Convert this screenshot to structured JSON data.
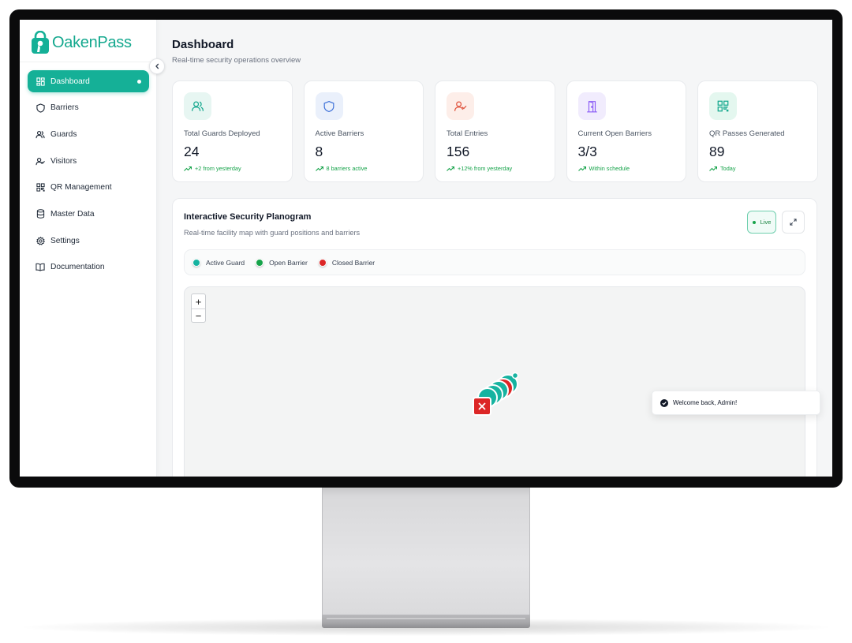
{
  "app": {
    "name": "OakenPass",
    "brand_color": "#15b097"
  },
  "sidebar": {
    "items": [
      {
        "label": "Dashboard",
        "icon": "dashboard-grid-icon",
        "active": true
      },
      {
        "label": "Barriers",
        "icon": "shield-icon"
      },
      {
        "label": "Guards",
        "icon": "users-icon"
      },
      {
        "label": "Visitors",
        "icon": "user-check-icon"
      },
      {
        "label": "QR Management",
        "icon": "qr-code-icon"
      },
      {
        "label": "Master Data",
        "icon": "database-icon"
      },
      {
        "label": "Settings",
        "icon": "gear-icon"
      },
      {
        "label": "Documentation",
        "icon": "book-icon"
      }
    ]
  },
  "header": {
    "title": "Dashboard",
    "subtitle": "Real-time security operations overview"
  },
  "stats": [
    {
      "label": "Total Guards Deployed",
      "value": "24",
      "trend": "+2 from yesterday",
      "icon": "users-icon",
      "icon_color": "#14a88e",
      "icon_bg": "#e7f6f2"
    },
    {
      "label": "Active Barriers",
      "value": "8",
      "trend": "8 barriers active",
      "icon": "shield-icon",
      "icon_color": "#3b6fd8",
      "icon_bg": "#eaf0fb"
    },
    {
      "label": "Total Entries",
      "value": "156",
      "trend": "+12% from yesterday",
      "icon": "user-check-icon",
      "icon_color": "#e0533d",
      "icon_bg": "#fdeee9"
    },
    {
      "label": "Current Open Barriers",
      "value": "3/3",
      "trend": "Within schedule",
      "icon": "door-open-icon",
      "icon_color": "#8b5cf6",
      "icon_bg": "#f1ecfd"
    },
    {
      "label": "QR Passes Generated",
      "value": "89",
      "trend": "Today",
      "icon": "qr-code-icon",
      "icon_color": "#14a88e",
      "icon_bg": "#e4f7ef"
    }
  ],
  "planogram": {
    "title": "Interactive Security Planogram",
    "subtitle": "Real-time facility map with guard positions and barriers",
    "live_label": "Live",
    "legend": [
      {
        "label": "Active Guard",
        "color": "#16b3a0"
      },
      {
        "label": "Open Barrier",
        "color": "#16a34a"
      },
      {
        "label": "Closed Barrier",
        "color": "#dc2626"
      }
    ],
    "zoom_in": "+",
    "zoom_out": "−"
  },
  "toast": {
    "message": "Welcome back, Admin!"
  }
}
